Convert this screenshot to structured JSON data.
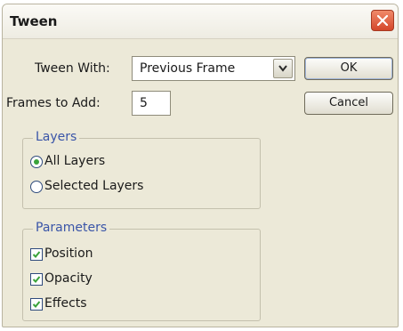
{
  "dialog": {
    "title": "Tween"
  },
  "tween_with": {
    "label": "Tween With:",
    "selected": "Previous Frame"
  },
  "frames_to_add": {
    "label": "Frames to Add:",
    "value": "5"
  },
  "buttons": {
    "ok": "OK",
    "cancel": "Cancel"
  },
  "layers": {
    "legend": "Layers",
    "options": [
      {
        "label": "All Layers",
        "selected": true
      },
      {
        "label": "Selected Layers",
        "selected": false
      }
    ]
  },
  "parameters": {
    "legend": "Parameters",
    "options": [
      {
        "label": "Position",
        "checked": true
      },
      {
        "label": "Opacity",
        "checked": true
      },
      {
        "label": "Effects",
        "checked": true
      }
    ]
  },
  "colors": {
    "accent": "#3a55a8",
    "check": "#3aa33a",
    "close": "#d4462a"
  },
  "icons": {
    "close": "close-icon",
    "dropdown": "chevron-down-icon",
    "check": "checkmark-icon"
  }
}
